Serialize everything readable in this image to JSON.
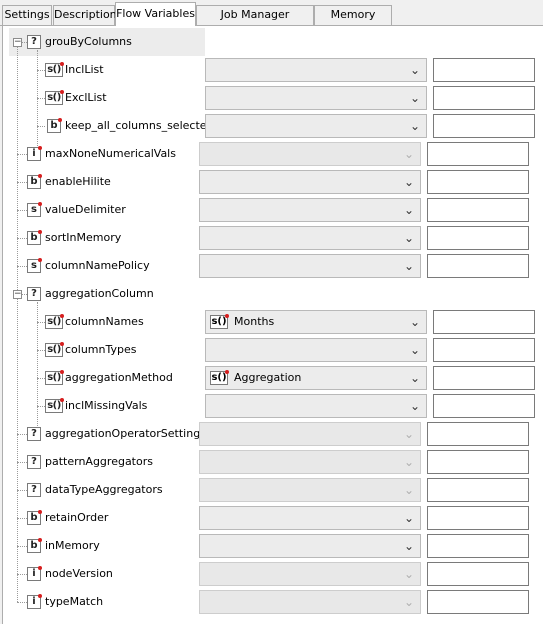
{
  "tabs": [
    {
      "label": "Settings",
      "active": false
    },
    {
      "label": "Description",
      "active": false
    },
    {
      "label": "Flow Variables",
      "active": true
    },
    {
      "label": "Job Manager Selection",
      "active": false
    },
    {
      "label": "Memory Policy",
      "active": false
    }
  ],
  "tree": {
    "groupByColumns": {
      "label": "grouByColumns",
      "icon": "?",
      "children": [
        {
          "label": "InclList",
          "icon": "s()",
          "selected": ""
        },
        {
          "label": "ExclList",
          "icon": "s()",
          "selected": ""
        },
        {
          "label": "keep_all_columns_selected",
          "icon": "b",
          "selected": ""
        }
      ]
    },
    "rows1": [
      {
        "label": "maxNoneNumericalVals",
        "icon": "i",
        "disabled": true
      },
      {
        "label": "enableHilite",
        "icon": "b",
        "disabled": false
      },
      {
        "label": "valueDelimiter",
        "icon": "s",
        "disabled": false
      },
      {
        "label": "sortInMemory",
        "icon": "b",
        "disabled": false
      },
      {
        "label": "columnNamePolicy",
        "icon": "s",
        "disabled": false
      }
    ],
    "aggregationColumn": {
      "label": "aggregationColumn",
      "icon": "?",
      "children": [
        {
          "label": "columnNames",
          "icon": "s()",
          "selected": "Months",
          "selected_icon": "s()"
        },
        {
          "label": "columnTypes",
          "icon": "s()",
          "selected": ""
        },
        {
          "label": "aggregationMethod",
          "icon": "s()",
          "selected": "Aggregation",
          "selected_icon": "s()"
        },
        {
          "label": "inclMissingVals",
          "icon": "s()",
          "selected": ""
        }
      ]
    },
    "rows2": [
      {
        "label": "aggregationOperatorSettings",
        "icon": "?",
        "disabled": true
      },
      {
        "label": "patternAggregators",
        "icon": "?",
        "disabled": true
      },
      {
        "label": "dataTypeAggregators",
        "icon": "?",
        "disabled": true
      },
      {
        "label": "retainOrder",
        "icon": "b",
        "disabled": false
      },
      {
        "label": "inMemory",
        "icon": "b",
        "disabled": false
      },
      {
        "label": "nodeVersion",
        "icon": "i",
        "disabled": true
      },
      {
        "label": "typeMatch",
        "icon": "i",
        "disabled": true
      }
    ]
  },
  "icons": {
    "expander": "minus-box-icon",
    "chevron": "chevron-down-icon",
    "flag_color": "#d61f1f"
  }
}
